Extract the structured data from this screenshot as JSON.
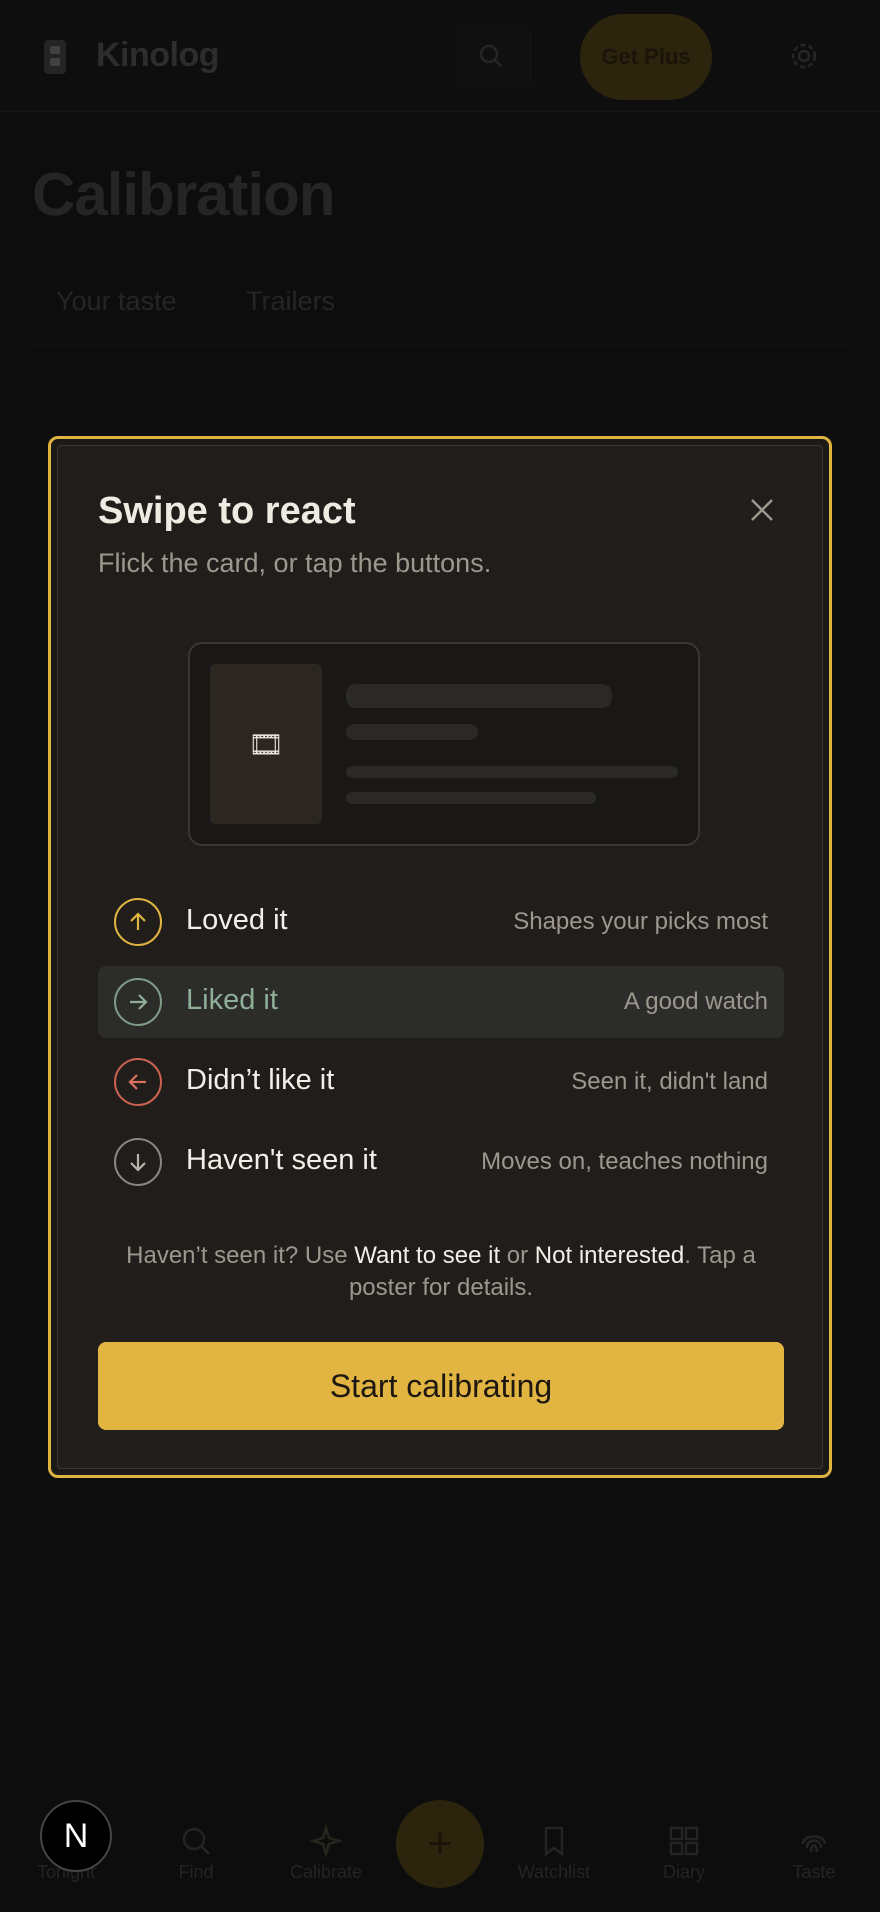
{
  "header": {
    "brand": "Kinolog",
    "plus_label": "Get Plus"
  },
  "page": {
    "title": "Calibration",
    "tabs": [
      {
        "label": "Your taste"
      },
      {
        "label": "Trailers"
      }
    ]
  },
  "modal": {
    "title": "Swipe to react",
    "subtitle": "Flick the card, or tap the buttons.",
    "reactions": [
      {
        "label": "Loved it",
        "hint": "Shapes your picks most",
        "icon": "arrow-up-icon",
        "color": "#e0b440"
      },
      {
        "label": "Liked it",
        "hint": "A good watch",
        "icon": "arrow-right-icon",
        "color": "#8fae97"
      },
      {
        "label": "Didn’t like it",
        "hint": "Seen it, didn't land",
        "icon": "arrow-left-icon",
        "color": "#d9705e"
      },
      {
        "label": "Haven't seen it",
        "hint": "Moves on, teaches nothing",
        "icon": "arrow-down-icon",
        "color": "#9d978e"
      }
    ],
    "note_before": "Haven’t seen it? Use ",
    "note_want": "Want to see it",
    "note_or": " or ",
    "note_not": "Not interested",
    "note_after": ". Tap a poster for details.",
    "cta_label": "Start calibrating"
  },
  "bottom_nav": {
    "items": [
      {
        "label": "Tonight"
      },
      {
        "label": "Find"
      },
      {
        "label": "Calibrate"
      },
      {
        "label": "Watchlist"
      },
      {
        "label": "Diary"
      },
      {
        "label": "Taste"
      }
    ],
    "badge_letter": "N"
  },
  "colors": {
    "accent": "#e2b441",
    "background": "#161616",
    "modal_bg": "#201d1b"
  }
}
